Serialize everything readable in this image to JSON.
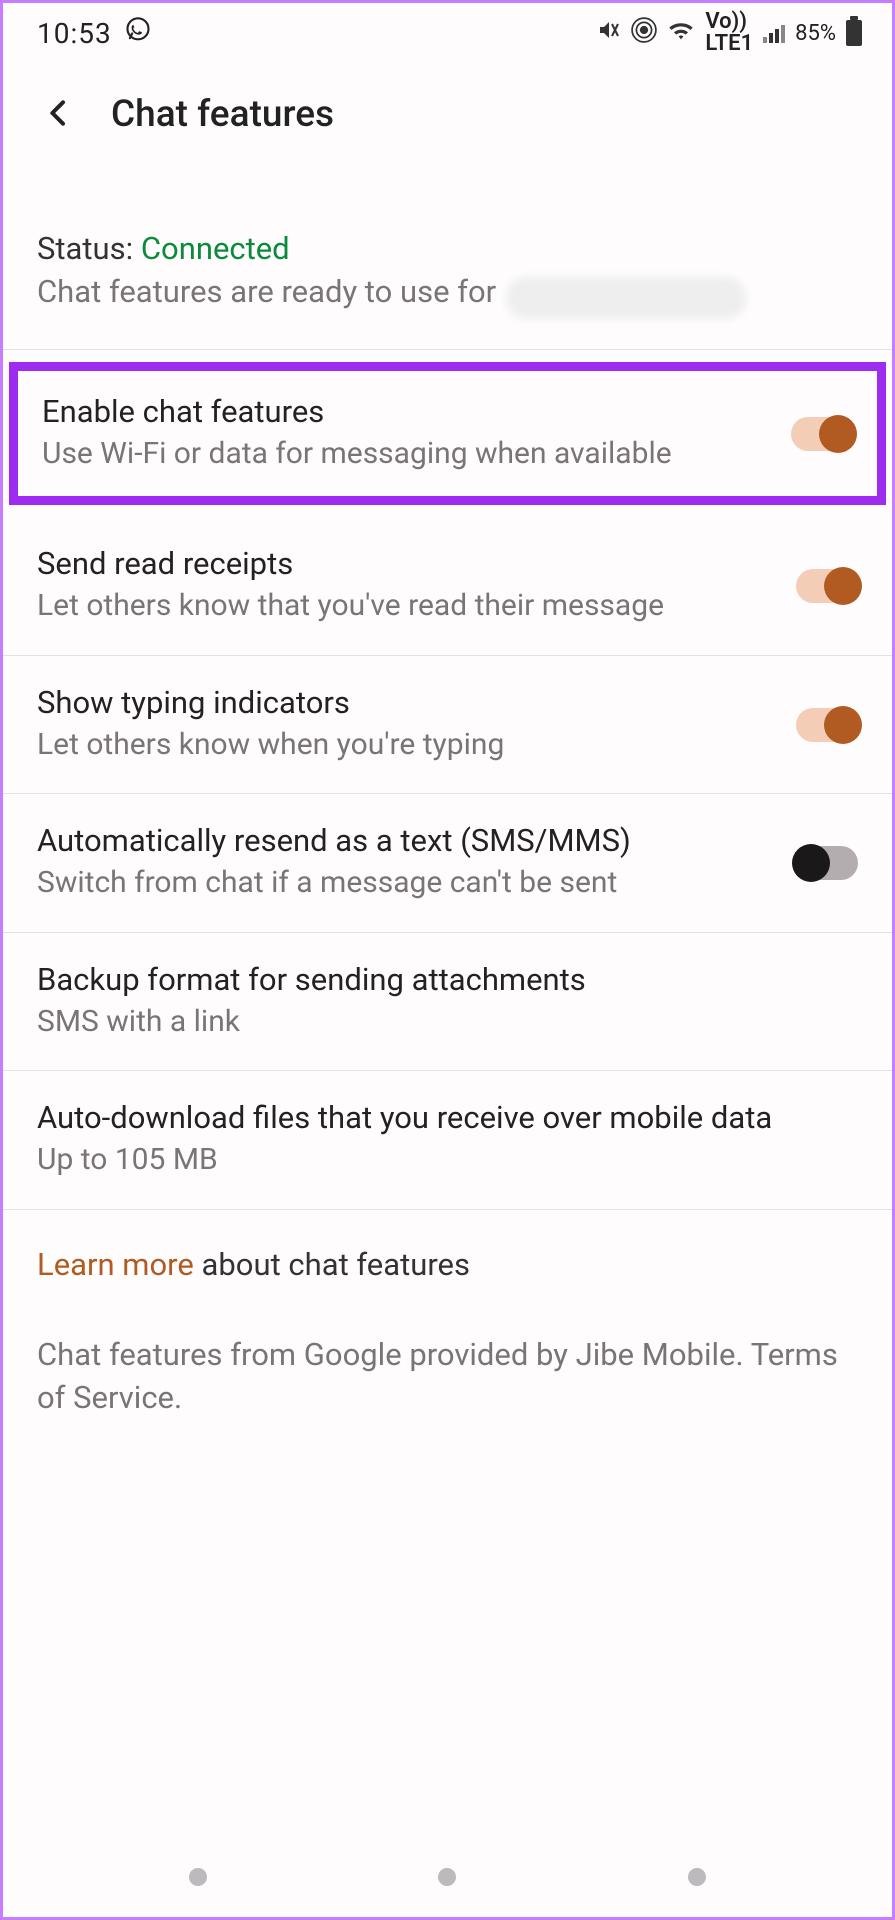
{
  "statusbar": {
    "time": "10:53",
    "battery": "85%",
    "volte": "Vo))\nLTE1"
  },
  "header": {
    "title": "Chat features"
  },
  "status": {
    "label": "Status: ",
    "value": "Connected",
    "desc": "Chat features are ready to use for"
  },
  "settings": {
    "enable": {
      "title": "Enable chat features",
      "desc": "Use Wi-Fi or data for messaging when available",
      "on": true
    },
    "readReceipts": {
      "title": "Send read receipts",
      "desc": "Let others know that you've read their message",
      "on": true
    },
    "typing": {
      "title": "Show typing indicators",
      "desc": "Let others know when you're typing",
      "on": true
    },
    "autoResend": {
      "title": "Automatically resend as a text (SMS/MMS)",
      "desc": "Switch from chat if a message can't be sent",
      "on": false
    },
    "backup": {
      "title": "Backup format for sending attachments",
      "desc": "SMS with a link"
    },
    "autoDownload": {
      "title": "Auto-download files that you receive over mobile data",
      "desc": "Up to 105 MB"
    }
  },
  "info": {
    "learnLink": "Learn more",
    "learnRest": " about chat features",
    "provider": "Chat features from Google provided by Jibe Mobile. Terms of Service."
  }
}
